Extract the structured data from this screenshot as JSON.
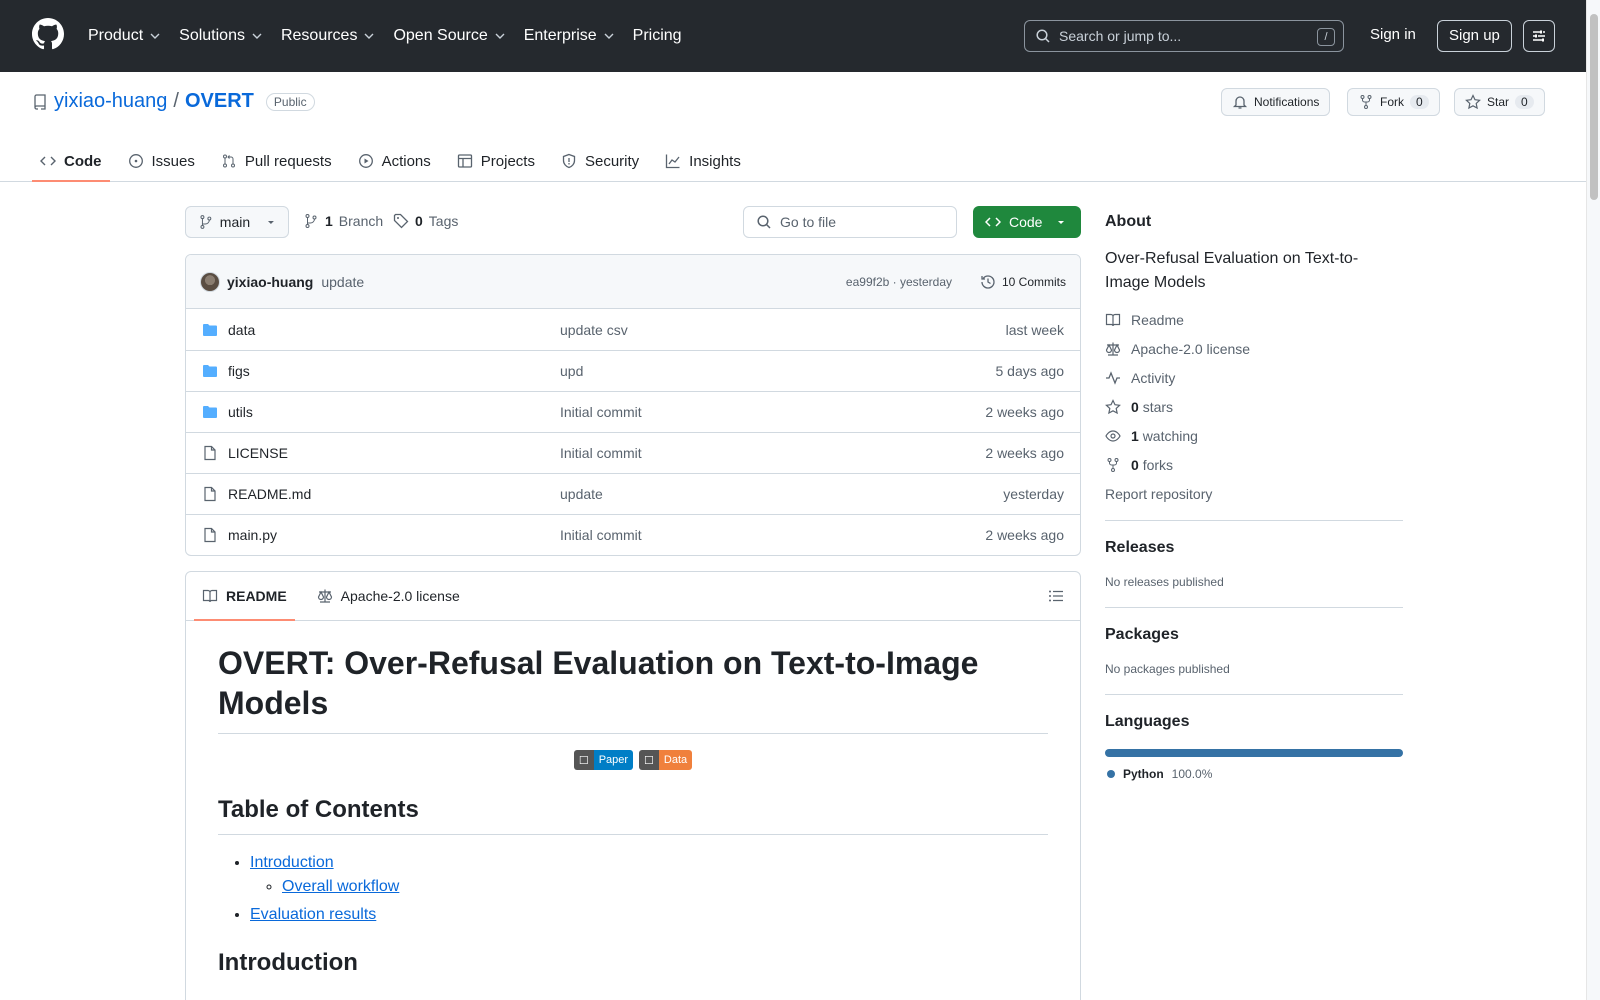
{
  "header": {
    "nav": [
      {
        "label": "Product",
        "dropdown": true
      },
      {
        "label": "Solutions",
        "dropdown": true
      },
      {
        "label": "Resources",
        "dropdown": true
      },
      {
        "label": "Open Source",
        "dropdown": true
      },
      {
        "label": "Enterprise",
        "dropdown": true
      },
      {
        "label": "Pricing",
        "dropdown": false
      }
    ],
    "search_placeholder": "Search or jump to...",
    "search_shortcut": "/",
    "signin": "Sign in",
    "signup": "Sign up"
  },
  "repo": {
    "owner": "yixiao-huang",
    "separator": "/",
    "name": "OVERT",
    "visibility": "Public",
    "notifications": "Notifications",
    "fork_label": "Fork",
    "fork_count": "0",
    "star_label": "Star",
    "star_count": "0"
  },
  "tabs": [
    "Code",
    "Issues",
    "Pull requests",
    "Actions",
    "Projects",
    "Security",
    "Insights"
  ],
  "toolbar": {
    "branch": "main",
    "branch_count": "1",
    "branch_label": "Branch",
    "tag_count": "0",
    "tag_label": "Tags",
    "goto_placeholder": "Go to file",
    "code_button": "Code"
  },
  "commit": {
    "author": "yixiao-huang",
    "message": "update",
    "hash_time": "ea99f2b · yesterday",
    "commits": "10 Commits"
  },
  "files": [
    {
      "type": "folder",
      "name": "data",
      "message": "update csv",
      "date": "last week"
    },
    {
      "type": "folder",
      "name": "figs",
      "message": "upd",
      "date": "5 days ago"
    },
    {
      "type": "folder",
      "name": "utils",
      "message": "Initial commit",
      "date": "2 weeks ago"
    },
    {
      "type": "file",
      "name": "LICENSE",
      "message": "Initial commit",
      "date": "2 weeks ago"
    },
    {
      "type": "file",
      "name": "README.md",
      "message": "update",
      "date": "yesterday"
    },
    {
      "type": "file",
      "name": "main.py",
      "message": "Initial commit",
      "date": "2 weeks ago"
    }
  ],
  "readme": {
    "tab_readme": "README",
    "tab_license": "Apache-2.0 license",
    "title": "OVERT: Over-Refusal Evaluation on Text-to-Image Models",
    "badge_paper": "Paper",
    "badge_data": "Data",
    "toc_heading": "Table of Contents",
    "toc_intro": "Introduction",
    "toc_workflow": "Overall workflow",
    "toc_results": "Evaluation results",
    "intro_heading": "Introduction"
  },
  "about": {
    "heading": "About",
    "description": "Over-Refusal Evaluation on Text-to-Image Models",
    "readme": "Readme",
    "license": "Apache-2.0 license",
    "activity": "Activity",
    "stars_count": "0",
    "stars_label": "stars",
    "watching_count": "1",
    "watching_label": "watching",
    "forks_count": "0",
    "forks_label": "forks",
    "report": "Report repository"
  },
  "releases": {
    "heading": "Releases",
    "text": "No releases published"
  },
  "packages": {
    "heading": "Packages",
    "text": "No packages published"
  },
  "languages": {
    "heading": "Languages",
    "name": "Python",
    "percent": "100.0%",
    "fraction": 1.0,
    "color": "#3572A5"
  }
}
